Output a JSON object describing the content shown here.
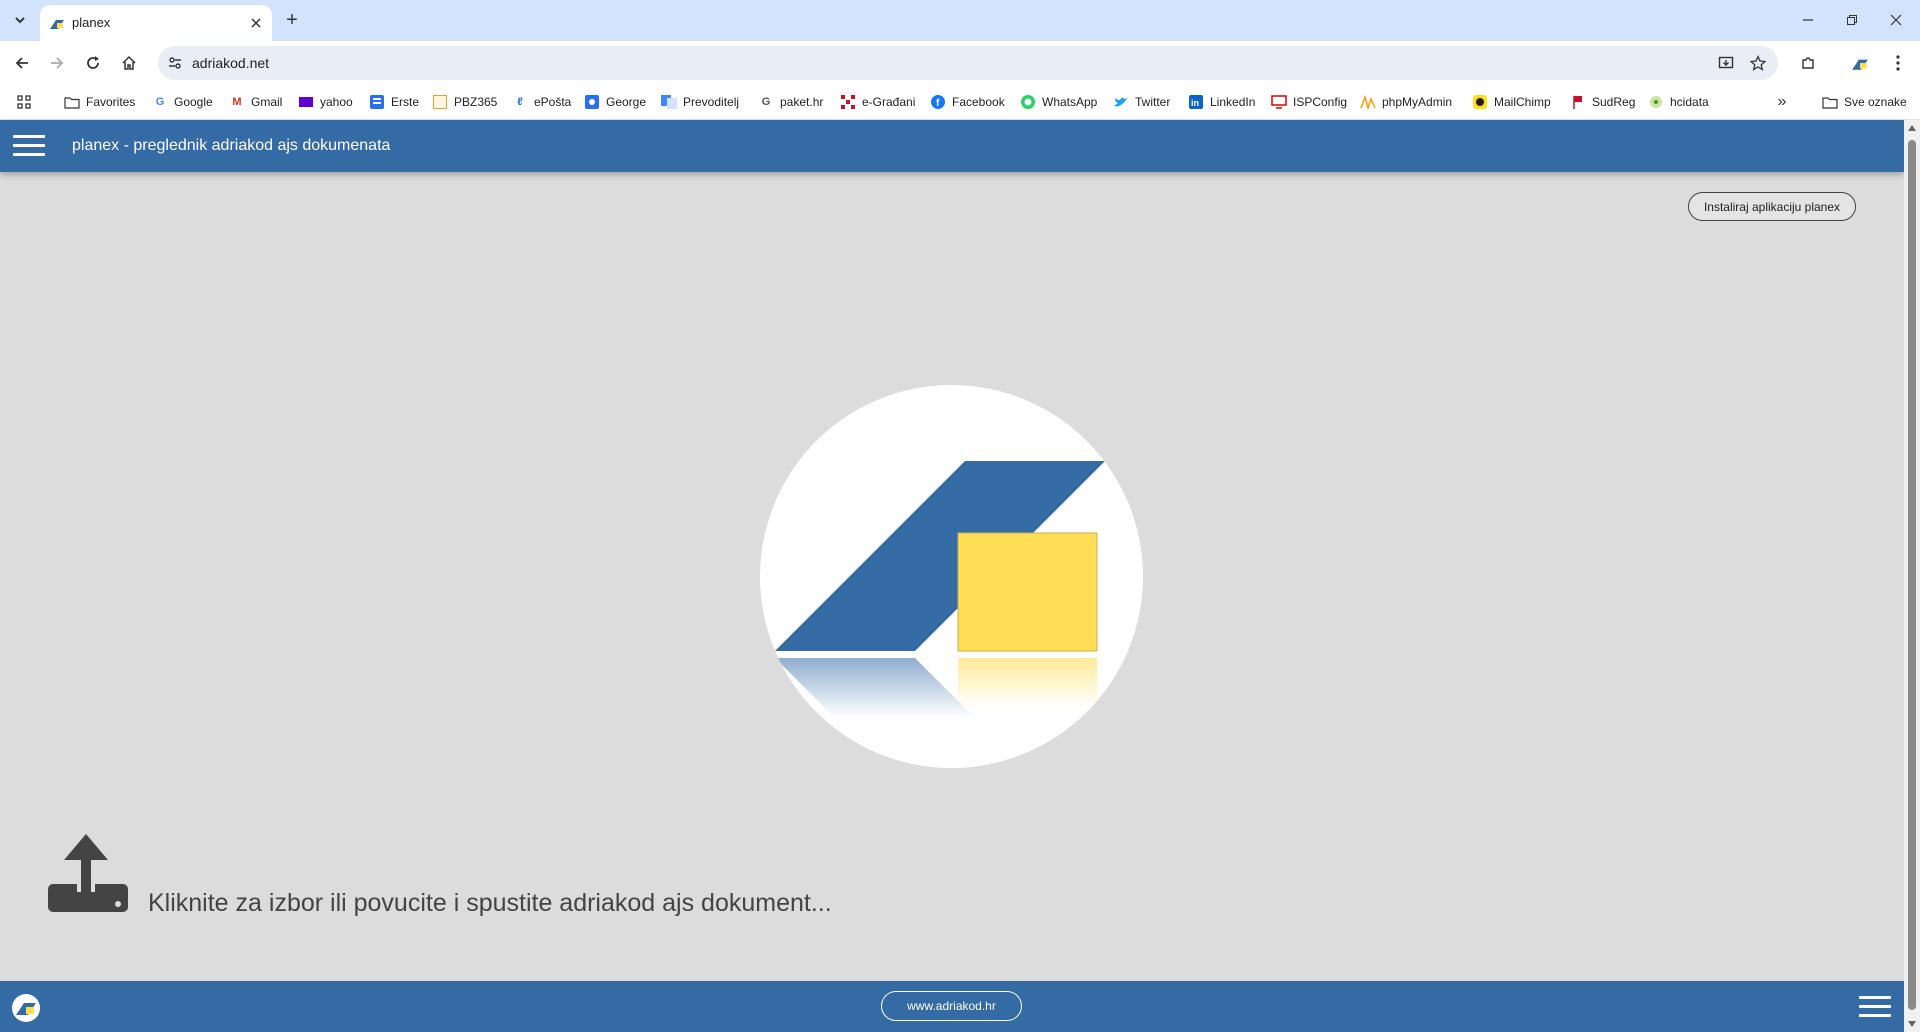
{
  "browser": {
    "tab_title": "planex",
    "new_tab": "+",
    "url": "adriakod.net",
    "bookmarks": [
      {
        "label": "Favorites",
        "icon": "folder-icon"
      },
      {
        "label": "Google",
        "icon": "google-icon"
      },
      {
        "label": "Gmail",
        "icon": "gmail-icon"
      },
      {
        "label": "yahoo",
        "icon": "yahoo-icon"
      },
      {
        "label": "Erste",
        "icon": "erste-icon"
      },
      {
        "label": "PBZ365",
        "icon": "pbz-icon"
      },
      {
        "label": "ePošta",
        "icon": "eposta-icon"
      },
      {
        "label": "George",
        "icon": "george-icon"
      },
      {
        "label": "Prevoditelj",
        "icon": "translate-icon"
      },
      {
        "label": "paket.hr",
        "icon": "google-icon"
      },
      {
        "label": "e-Građani",
        "icon": "egradjani-icon"
      },
      {
        "label": "Facebook",
        "icon": "facebook-icon"
      },
      {
        "label": "WhatsApp",
        "icon": "whatsapp-icon"
      },
      {
        "label": "Twitter",
        "icon": "twitter-icon"
      },
      {
        "label": "LinkedIn",
        "icon": "linkedin-icon"
      },
      {
        "label": "ISPConfig",
        "icon": "ispconfig-icon"
      },
      {
        "label": "phpMyAdmin",
        "icon": "phpmyadmin-icon"
      },
      {
        "label": "MailChimp",
        "icon": "mailchimp-icon"
      },
      {
        "label": "SudReg",
        "icon": "sudreg-icon"
      },
      {
        "label": "hcidata",
        "icon": "hcidata-icon"
      }
    ],
    "bookmarks_more": "»",
    "all_bookmarks": "Sve oznake"
  },
  "app": {
    "header_title": "planex - preglednik adriakod ajs dokumenata",
    "install_button": "Instaliraj aplikaciju planex",
    "upload_prompt": "Kliknite za izbor ili povucite i spustite adriakod ajs dokument...",
    "footer_link": "www.adriakod.hr"
  },
  "colors": {
    "brand_blue": "#346ba5",
    "brand_yellow": "#ffdd55",
    "background": "#dcdcdc"
  }
}
